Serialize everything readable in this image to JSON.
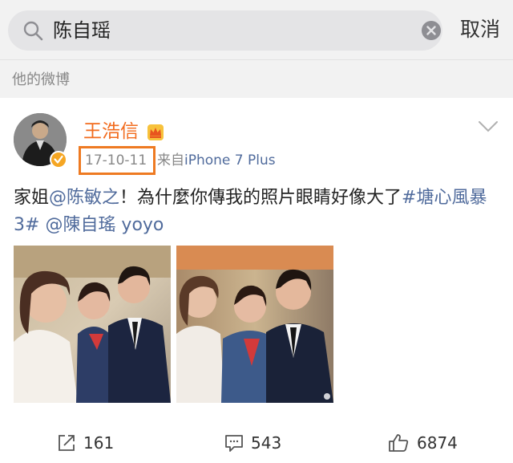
{
  "search": {
    "query": "陈自瑶",
    "cancel_label": "取消"
  },
  "section": {
    "title": "他的微博"
  },
  "post": {
    "author": "王浩信",
    "date": "17-10-11",
    "source_prefix": "来自",
    "source_name": "iPhone 7 Plus",
    "text_1": "家姐",
    "mention_1": "@陈敏之",
    "text_2": "！為什麼你傳我的照片眼睛好像大了",
    "hashtag": "#塘心風暴 3#",
    "mention_2": "@陳自瑤 yoyo",
    "reposts": "161",
    "comments": "543",
    "likes": "6874"
  },
  "icons": {
    "search": "search-icon",
    "clear": "clear-icon",
    "verified": "verified-badge-icon",
    "crown": "crown-icon",
    "more": "chevron-down-icon",
    "repost": "repost-icon",
    "comment": "comment-icon",
    "like": "thumbs-up-icon"
  },
  "colors": {
    "author_name": "#f26b1d",
    "link": "#506b9c",
    "highlight_box": "#ee7a22",
    "header_bg": "#f2f2f2"
  }
}
